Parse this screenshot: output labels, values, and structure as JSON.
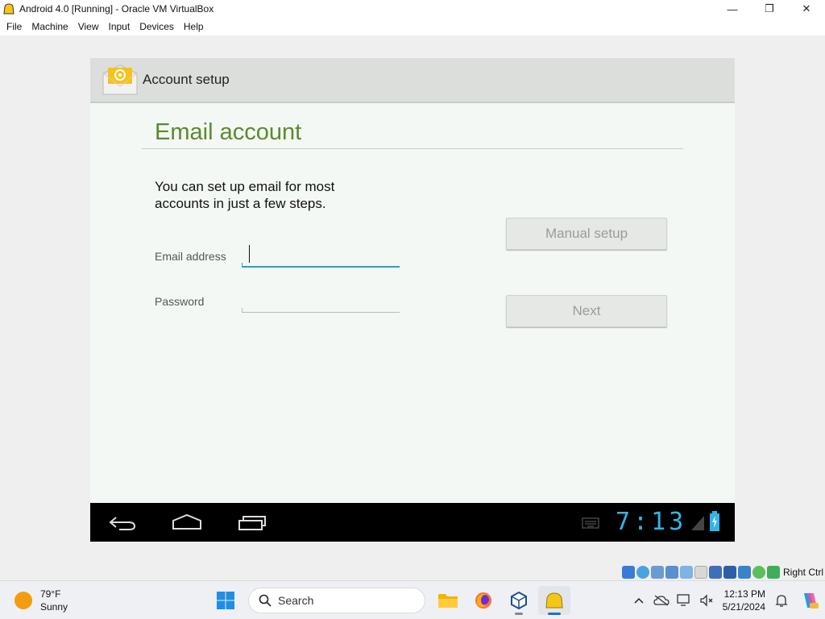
{
  "window": {
    "title": "Android 4.0 [Running] - Oracle VM VirtualBox",
    "minimize": "—",
    "maximize": "❐",
    "close": "✕"
  },
  "menu": [
    "File",
    "Machine",
    "View",
    "Input",
    "Devices",
    "Help"
  ],
  "android": {
    "actionbar_title": "Account setup",
    "heading": "Email account",
    "intro": "You can set up email for most accounts in just a few steps.",
    "email_label": "Email address",
    "email_value": "",
    "password_label": "Password",
    "password_value": "",
    "manual_setup_label": "Manual setup",
    "next_label": "Next",
    "clock": "7:13",
    "accent_color": "#33b5e5",
    "heading_color": "#5b8a2e"
  },
  "vbox_status": {
    "host_key": "Right Ctrl"
  },
  "taskbar": {
    "weather_temp": "79°F",
    "weather_desc": "Sunny",
    "search_label": "Search",
    "time": "12:13 PM",
    "date": "5/21/2024"
  }
}
